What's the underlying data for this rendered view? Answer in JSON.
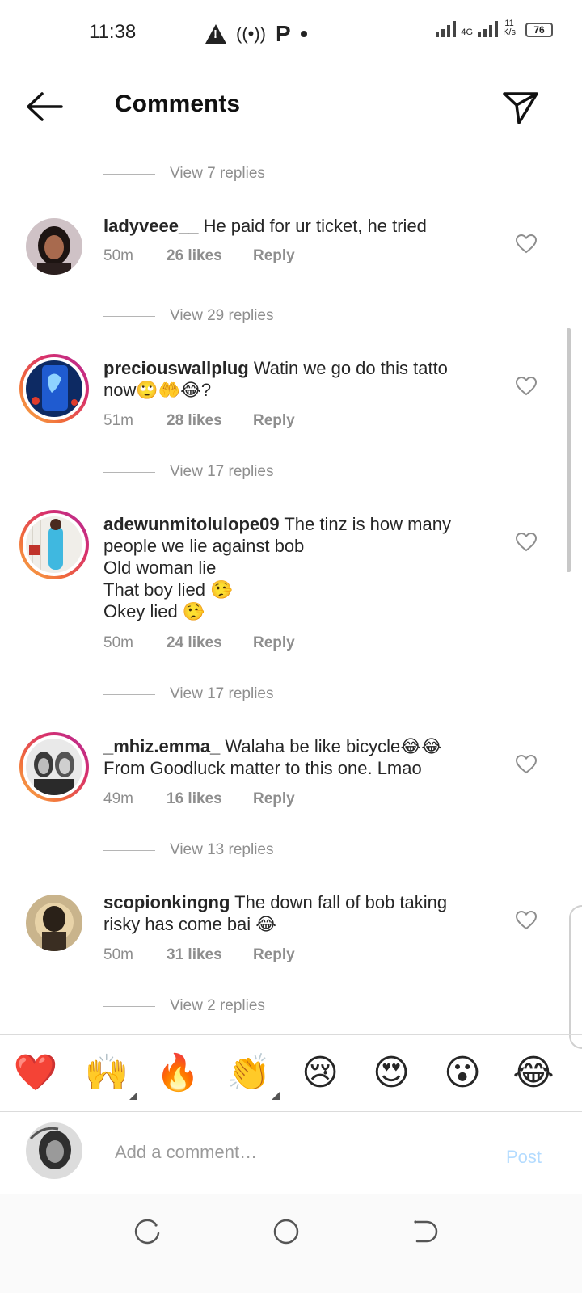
{
  "status_bar": {
    "time": "11:38",
    "network": "4G",
    "speed_value": "11",
    "speed_unit": "K/s",
    "battery": "76"
  },
  "header": {
    "title": "Comments",
    "back_icon": "arrow-left-icon",
    "send_icon": "paper-plane-icon"
  },
  "comments": [
    {
      "username": "ladyveee__",
      "text": "He paid for ur ticket, he tried",
      "time": "50m",
      "likes": "26 likes",
      "reply_label": "Reply",
      "has_story": false
    },
    {
      "username": "preciouswallplug",
      "text": "Watin we go do this tatto now🙄🤲😂?",
      "time": "51m",
      "likes": "28 likes",
      "reply_label": "Reply",
      "has_story": true
    },
    {
      "username": "adewunmitolulope09",
      "text": "The tinz is how many people we lie against bob\nOld woman lie\nThat boy lied 🤥\nOkey lied 🤥",
      "time": "50m",
      "likes": "24 likes",
      "reply_label": "Reply",
      "has_story": true
    },
    {
      "username": "_mhiz.emma_",
      "text": "Walaha be like bicycle😂😂\nFrom Goodluck matter to this one. Lmao",
      "time": "49m",
      "likes": "16 likes",
      "reply_label": "Reply",
      "has_story": true
    },
    {
      "username": "scopionkingng",
      "text": "The down fall of bob taking risky has come bai 😂",
      "time": "50m",
      "likes": "31 likes",
      "reply_label": "Reply",
      "has_story": false
    }
  ],
  "view_replies": [
    "View 7 replies",
    "View 29 replies",
    "View 17 replies",
    "View 17 replies",
    "View 13 replies",
    "View 2 replies"
  ],
  "reactions": [
    "❤️",
    "🙌",
    "🔥",
    "👏",
    "😢",
    "😍",
    "😮",
    "😂"
  ],
  "add_comment": {
    "placeholder": "Add a comment…",
    "post_label": "Post"
  },
  "colors": {
    "post_disabled": "#b3dbff",
    "muted_text": "#8e8e8e",
    "story_ring": "#d8306c"
  }
}
